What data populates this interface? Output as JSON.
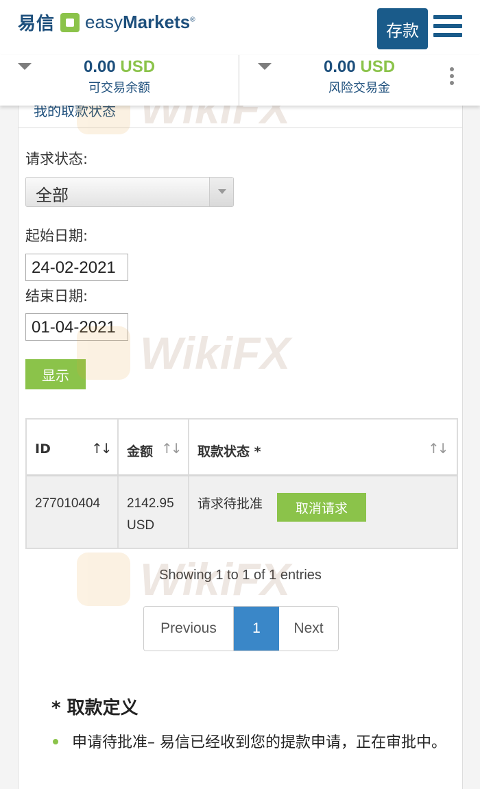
{
  "header": {
    "logo_cn": "易信",
    "logo_en_light": "easy",
    "logo_en_bold": "Markets",
    "logo_reg": "®",
    "deposit_label": "存款"
  },
  "balances": [
    {
      "value": "0.00",
      "currency": "USD",
      "label": "可交易余额"
    },
    {
      "value": "0.00",
      "currency": "USD",
      "label": "风险交易金"
    }
  ],
  "page": {
    "title": "我的取款状态"
  },
  "filters": {
    "status_label": "请求状态:",
    "status_value": "全部",
    "start_label": "起始日期:",
    "start_value": "24-02-2021",
    "end_label": "结束日期:",
    "end_value": "01-04-2021",
    "show_button": "显示"
  },
  "table": {
    "columns": [
      "ID",
      "金额",
      "取款状态 *"
    ],
    "sort_glyph": "↑↓",
    "rows": [
      {
        "id": "277010404",
        "amount_value": "2142.95",
        "amount_currency": "USD",
        "status": "请求待批准",
        "action": "取消请求"
      }
    ]
  },
  "pagination": {
    "info": "Showing 1 to 1 of 1 entries",
    "previous": "Previous",
    "current": "1",
    "next": "Next"
  },
  "definitions": {
    "title": "* 取款定义",
    "items": [
      "申请待批准– 易信已经收到您的提款申请，正在审批中。"
    ]
  },
  "watermark": {
    "text": "WikiFX"
  },
  "colors": {
    "brand_blue": "#1a5b8a",
    "brand_green": "#8bc34a",
    "page_active": "#3a87c8"
  }
}
